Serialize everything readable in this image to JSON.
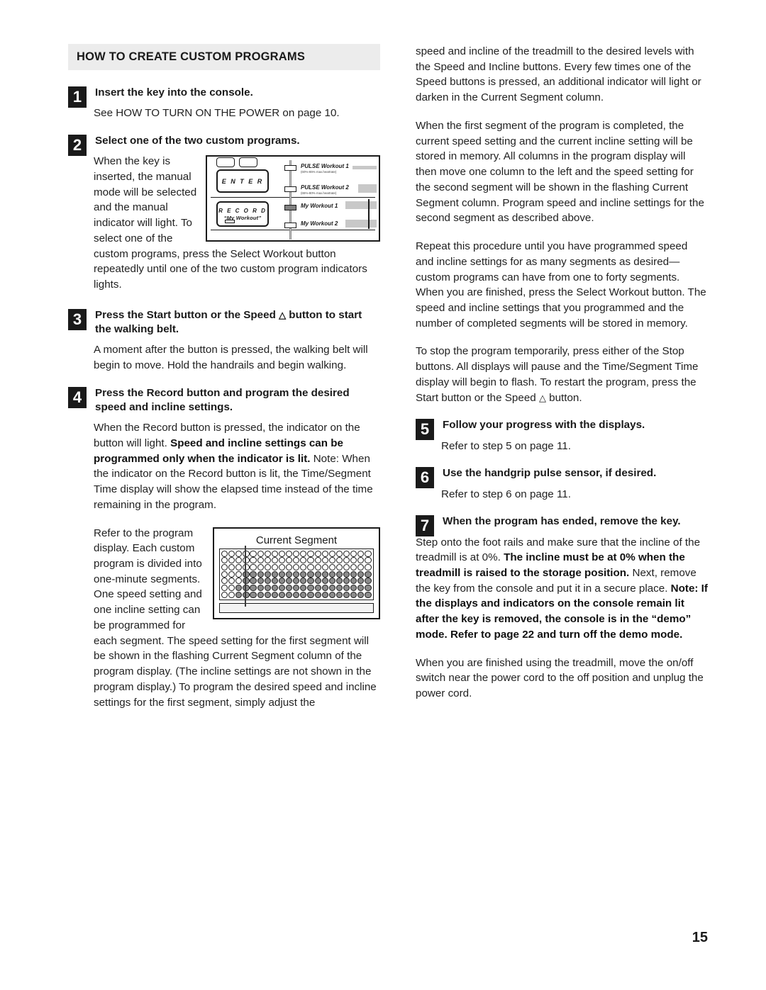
{
  "document": {
    "page_number": "15",
    "section_heading": "HOW TO CREATE CUSTOM PROGRAMS"
  },
  "left_column": {
    "step1": {
      "number": "1",
      "title": "Insert the key into the console.",
      "body": "See HOW TO TURN ON THE POWER on page 10."
    },
    "step2": {
      "number": "2",
      "title": "Select one of the two custom programs.",
      "body": "When the key is inserted, the manual mode will be selected and the manual indicator will light. To select one of the custom programs, press the Select Workout button repeatedly until one of the two custom program indicators lights."
    },
    "step3": {
      "number": "3",
      "title_part1": "Press the Start button or the Speed ",
      "title_triangle": "△",
      "title_part2": " button to start the walking belt.",
      "body": "A moment after the button is pressed, the walking belt will begin to move. Hold the handrails and begin walking."
    },
    "step4": {
      "number": "4",
      "title": "Press the Record button and program the desired speed and incline settings.",
      "body_a": "When the Record button is pressed, the indicator on the button will light. ",
      "body_b_bold": "Speed and incline settings can be programmed only when the indicator is lit.",
      "body_c": " Note: When the indicator on the Record button is lit, the Time/Segment Time display will show the elapsed time instead of the time remaining in the program.",
      "body2": "Refer to the program display. Each custom program is divided into one-minute segments. One speed setting and one incline setting can be programmed for each segment. The speed setting for the first segment will be shown in the flashing Current Segment column of the program display. (The incline settings are not shown in the program display.) To program the desired speed and incline settings for the first segment, simply adjust the"
    },
    "console_figure": {
      "enter_label": "E N T E R",
      "record_label": "R E C O R D",
      "record_sub": "“My Workout”",
      "indicators": [
        {
          "label": "PULSE Workout 1",
          "sub": "(60%-65% max.heartrate)",
          "lit": false
        },
        {
          "label": "PULSE Workout 2",
          "sub": "(65%-80% max.heartrate)",
          "lit": false
        },
        {
          "label": "My Workout 1",
          "sub": "",
          "lit": true
        },
        {
          "label": "My Workout 2",
          "sub": "",
          "lit": false
        }
      ]
    },
    "program_figure": {
      "caption": "Current Segment",
      "rows": 7,
      "columns": 21,
      "filled_from_row": 3,
      "filled_from_col": 3
    }
  },
  "right_column": {
    "para1": "speed and incline of the treadmill to the desired levels with the Speed and Incline buttons. Every few times one of the Speed buttons is pressed, an additional indicator will light or darken in the Current Segment column.",
    "para2": "When the first segment of the program is completed, the current speed setting and the current incline setting will be stored in memory. All columns in the program display will then move one column to the left and the speed setting for the second segment will be shown in the flashing Current Segment column. Program speed and incline settings for the second segment as described above.",
    "para3": "Repeat this procedure until you have programmed speed and incline settings for as many segments as desired—custom programs can have from one to forty segments. When you are finished, press the Select Workout button. The speed and incline settings that you programmed and the number of completed segments will be stored in memory.",
    "para4_a": "To stop the program temporarily, press either of the Stop buttons. All displays will pause and the Time/Segment Time display will begin to flash. To restart the program, press the Start button or the Speed ",
    "para4_triangle": "△",
    "para4_b": " button.",
    "step5": {
      "number": "5",
      "title": "Follow your progress with the displays.",
      "body": "Refer to step 5 on page 11."
    },
    "step6": {
      "number": "6",
      "title": "Use the handgrip pulse sensor, if desired.",
      "body": "Refer to step 6 on page 11."
    },
    "step7": {
      "number": "7",
      "title": "When the program has ended, remove the key.",
      "body_a": "Step onto the foot rails and make sure that the incline of the treadmill is at 0%. ",
      "body_b_bold": "The incline must be at 0% when the treadmill is raised to the storage position.",
      "body_c": " Next, remove the key from the console and put it in a secure place. ",
      "body_d_bold": "Note: If the displays and indicators on the console remain lit after the key is removed, the console is in the “demo” mode. Refer to page 22 and turn off the demo mode.",
      "body2": "When you are finished using the treadmill, move the on/off switch near the power cord to the off position and unplug the power cord."
    }
  }
}
